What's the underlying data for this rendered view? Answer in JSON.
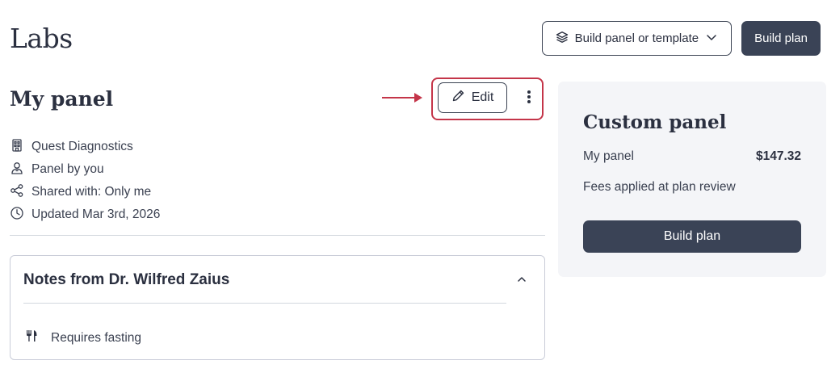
{
  "page": {
    "title": "Labs"
  },
  "header": {
    "build_panel_label": "Build panel or template",
    "build_plan_label": "Build plan"
  },
  "panel": {
    "title": "My panel",
    "edit_label": "Edit",
    "meta": {
      "lab": "Quest Diagnostics",
      "author": "Panel by you",
      "shared": "Shared with: Only me",
      "updated": "Updated Mar 3rd, 2026"
    }
  },
  "notes": {
    "title": "Notes from Dr. Wilfred Zaius",
    "items": [
      "Requires fasting"
    ]
  },
  "summary": {
    "title": "Custom panel",
    "item_label": "My panel",
    "item_price": "$147.32",
    "fees_note": "Fees applied at plan review",
    "button_label": "Build plan"
  },
  "colors": {
    "primary_dark": "#3a4356",
    "highlight": "#c43549",
    "summary_bg": "#f4f5f8"
  },
  "icons": {
    "build_panel": "layers-icon",
    "chevron": "chevron-down-icon",
    "edit": "pencil-icon",
    "more": "more-vertical-icon",
    "lab": "building-icon",
    "author": "user-icon",
    "shared": "share-icon",
    "updated": "clock-icon",
    "collapse": "chevron-up-icon",
    "fasting": "utensils-icon"
  }
}
